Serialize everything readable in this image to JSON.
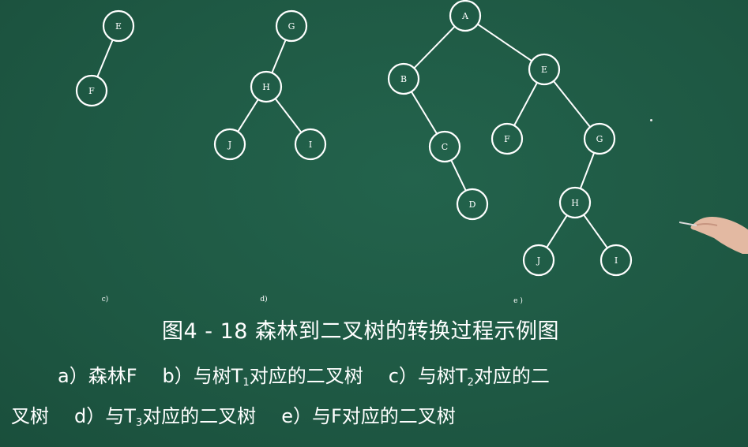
{
  "trees": {
    "c": {
      "label": "c)",
      "nodes": [
        {
          "id": "E",
          "label": "E"
        },
        {
          "id": "F",
          "label": "F"
        }
      ],
      "edges": [
        [
          "E",
          "F"
        ]
      ]
    },
    "d": {
      "label": "d)",
      "nodes": [
        {
          "id": "G",
          "label": "G"
        },
        {
          "id": "H",
          "label": "H"
        },
        {
          "id": "J",
          "label": "J"
        },
        {
          "id": "I",
          "label": "I"
        }
      ],
      "edges": [
        [
          "G",
          "H"
        ],
        [
          "H",
          "J"
        ],
        [
          "H",
          "I"
        ]
      ]
    },
    "e": {
      "label": "e )",
      "nodes": [
        {
          "id": "A",
          "label": "A"
        },
        {
          "id": "B",
          "label": "B"
        },
        {
          "id": "E",
          "label": "E"
        },
        {
          "id": "C",
          "label": "C"
        },
        {
          "id": "D",
          "label": "D"
        },
        {
          "id": "F",
          "label": "F"
        },
        {
          "id": "G",
          "label": "G"
        },
        {
          "id": "H",
          "label": "H"
        },
        {
          "id": "J",
          "label": "J"
        },
        {
          "id": "I",
          "label": "I"
        }
      ],
      "edges": [
        [
          "A",
          "B"
        ],
        [
          "A",
          "E"
        ],
        [
          "B",
          "C"
        ],
        [
          "C",
          "D"
        ],
        [
          "E",
          "F"
        ],
        [
          "E",
          "G"
        ],
        [
          "G",
          "H"
        ],
        [
          "H",
          "J"
        ],
        [
          "H",
          "I"
        ]
      ]
    }
  },
  "caption": {
    "title": "图4 - 18 森林到二叉树的转换过程示例图",
    "a": "a）森林F",
    "b_pre": "b）与树T",
    "b_sub": "1",
    "b_post": "对应的二叉树",
    "c_pre": "c）与树T",
    "c_sub": "2",
    "c_post": "对应的二",
    "c_cont": "叉树",
    "d_pre": "d）与T",
    "d_sub": "3",
    "d_post": "对应的二叉树",
    "e": "e）与F对应的二叉树"
  },
  "colors": {
    "board": "#1f5a45",
    "chalk": "#ffffff"
  }
}
